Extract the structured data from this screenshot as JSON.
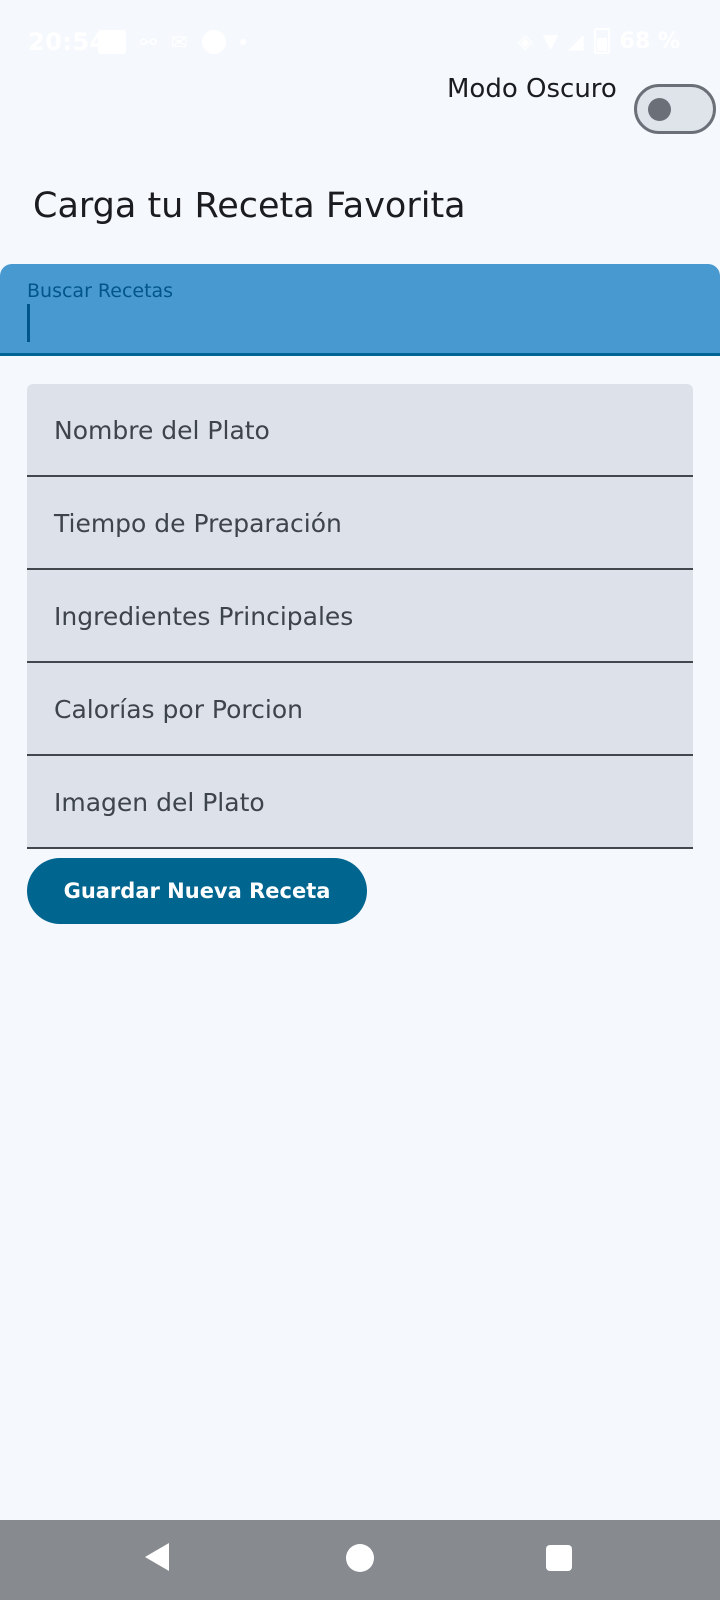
{
  "status_bar": {
    "time": "20:54",
    "battery_percent": "68 %"
  },
  "header": {
    "dark_mode_label": "Modo Oscuro",
    "dark_mode_enabled": false
  },
  "page": {
    "title": "Carga tu Receta Favorita"
  },
  "search": {
    "label": "Buscar Recetas",
    "value": ""
  },
  "form": {
    "fields": [
      {
        "label": "Nombre del Plato"
      },
      {
        "label": "Tiempo de Preparación"
      },
      {
        "label": "Ingredientes Principales"
      },
      {
        "label": "Calorías por Porcion"
      },
      {
        "label": "Imagen del Plato"
      }
    ],
    "submit_label": "Guardar Nueva Receta"
  },
  "colors": {
    "background": "#f5f8fc",
    "search_fill": "#4799cf",
    "accent": "#00658f",
    "field_fill": "#dde2ea",
    "nav_bar": "#878b90"
  },
  "icons": {
    "nav": [
      "back-icon",
      "home-icon",
      "recents-icon"
    ]
  }
}
